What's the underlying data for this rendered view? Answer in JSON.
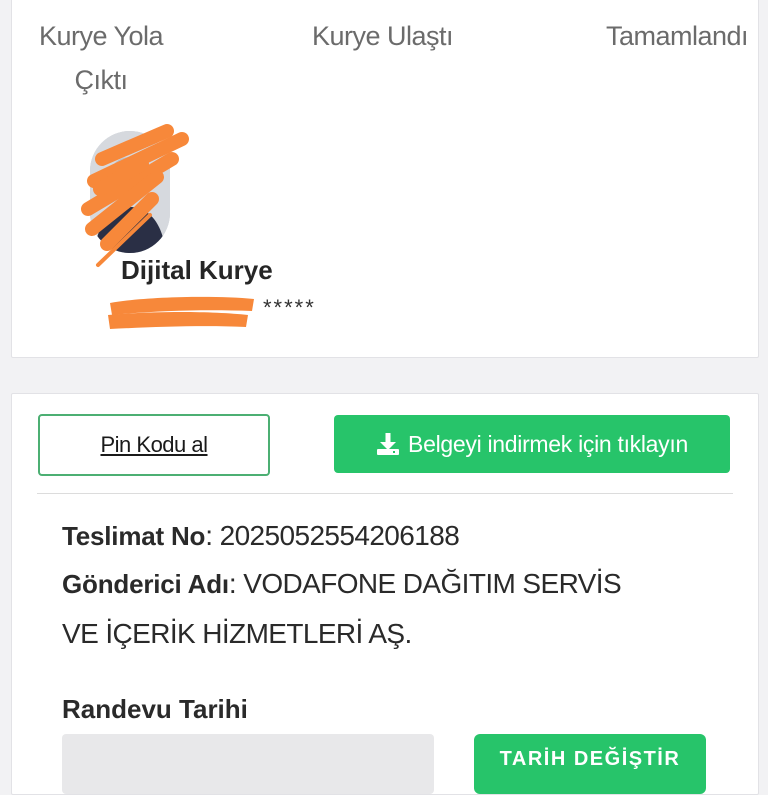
{
  "status_steps": [
    {
      "label": "Kurye Yola Çıktı"
    },
    {
      "label": "Kurye Ulaştı"
    },
    {
      "label": "Tamamlandı"
    }
  ],
  "courier": {
    "name": "Dijital Kurye",
    "phone_masked": "*****"
  },
  "actions": {
    "pin_label": "Pin Kodu al",
    "download_label": "Belgeyi indirmek için tıklayın",
    "download_icon": "download-icon"
  },
  "delivery": {
    "tracking_label": "Teslimat No",
    "tracking_value": "2025052554206188",
    "sender_label": "Gönderici Adı",
    "sender_value_line1": "VODAFONE DAĞITIM SERVİS",
    "sender_value_line2": "VE İÇERİK HİZMETLERİ AŞ."
  },
  "appointment": {
    "label": "Randevu Tarihi",
    "change_label": "TARİH DEĞİŞTİR"
  },
  "colors": {
    "accent_green": "#27c46a",
    "outline_green": "#4caf73",
    "redaction_orange": "#f7883a"
  }
}
